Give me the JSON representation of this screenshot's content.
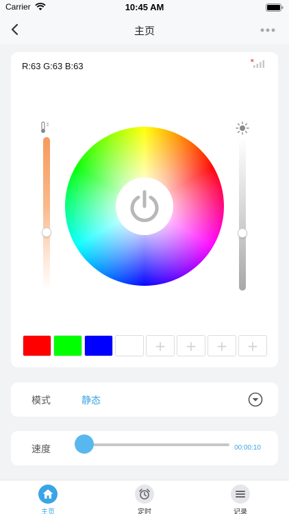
{
  "status_bar": {
    "carrier": "Carrier",
    "time": "10:45 AM"
  },
  "nav": {
    "title": "主页"
  },
  "rgb": {
    "r": 63,
    "g": 63,
    "b": 63,
    "text": "R:63 G:63 B:63"
  },
  "sliders": {
    "temperature_level": 0.62,
    "brightness_level": 0.62
  },
  "swatches": {
    "colors": [
      "#ff0000",
      "#00ff00",
      "#0000ff",
      "#ffffff"
    ],
    "empty_slot_symbol": "+",
    "empty_slots": 4
  },
  "mode": {
    "label": "模式",
    "value": "静态"
  },
  "speed": {
    "label": "速度",
    "time": "00:00:10",
    "level": 0.0
  },
  "tabs": [
    {
      "label": "主页",
      "icon": "home-icon",
      "active": true
    },
    {
      "label": "定时",
      "icon": "alarm-clock-icon",
      "active": false
    },
    {
      "label": "记录",
      "icon": "list-icon",
      "active": false
    }
  ],
  "colors": {
    "accent": "#3aa4e6",
    "background": "#f2f3f5"
  }
}
